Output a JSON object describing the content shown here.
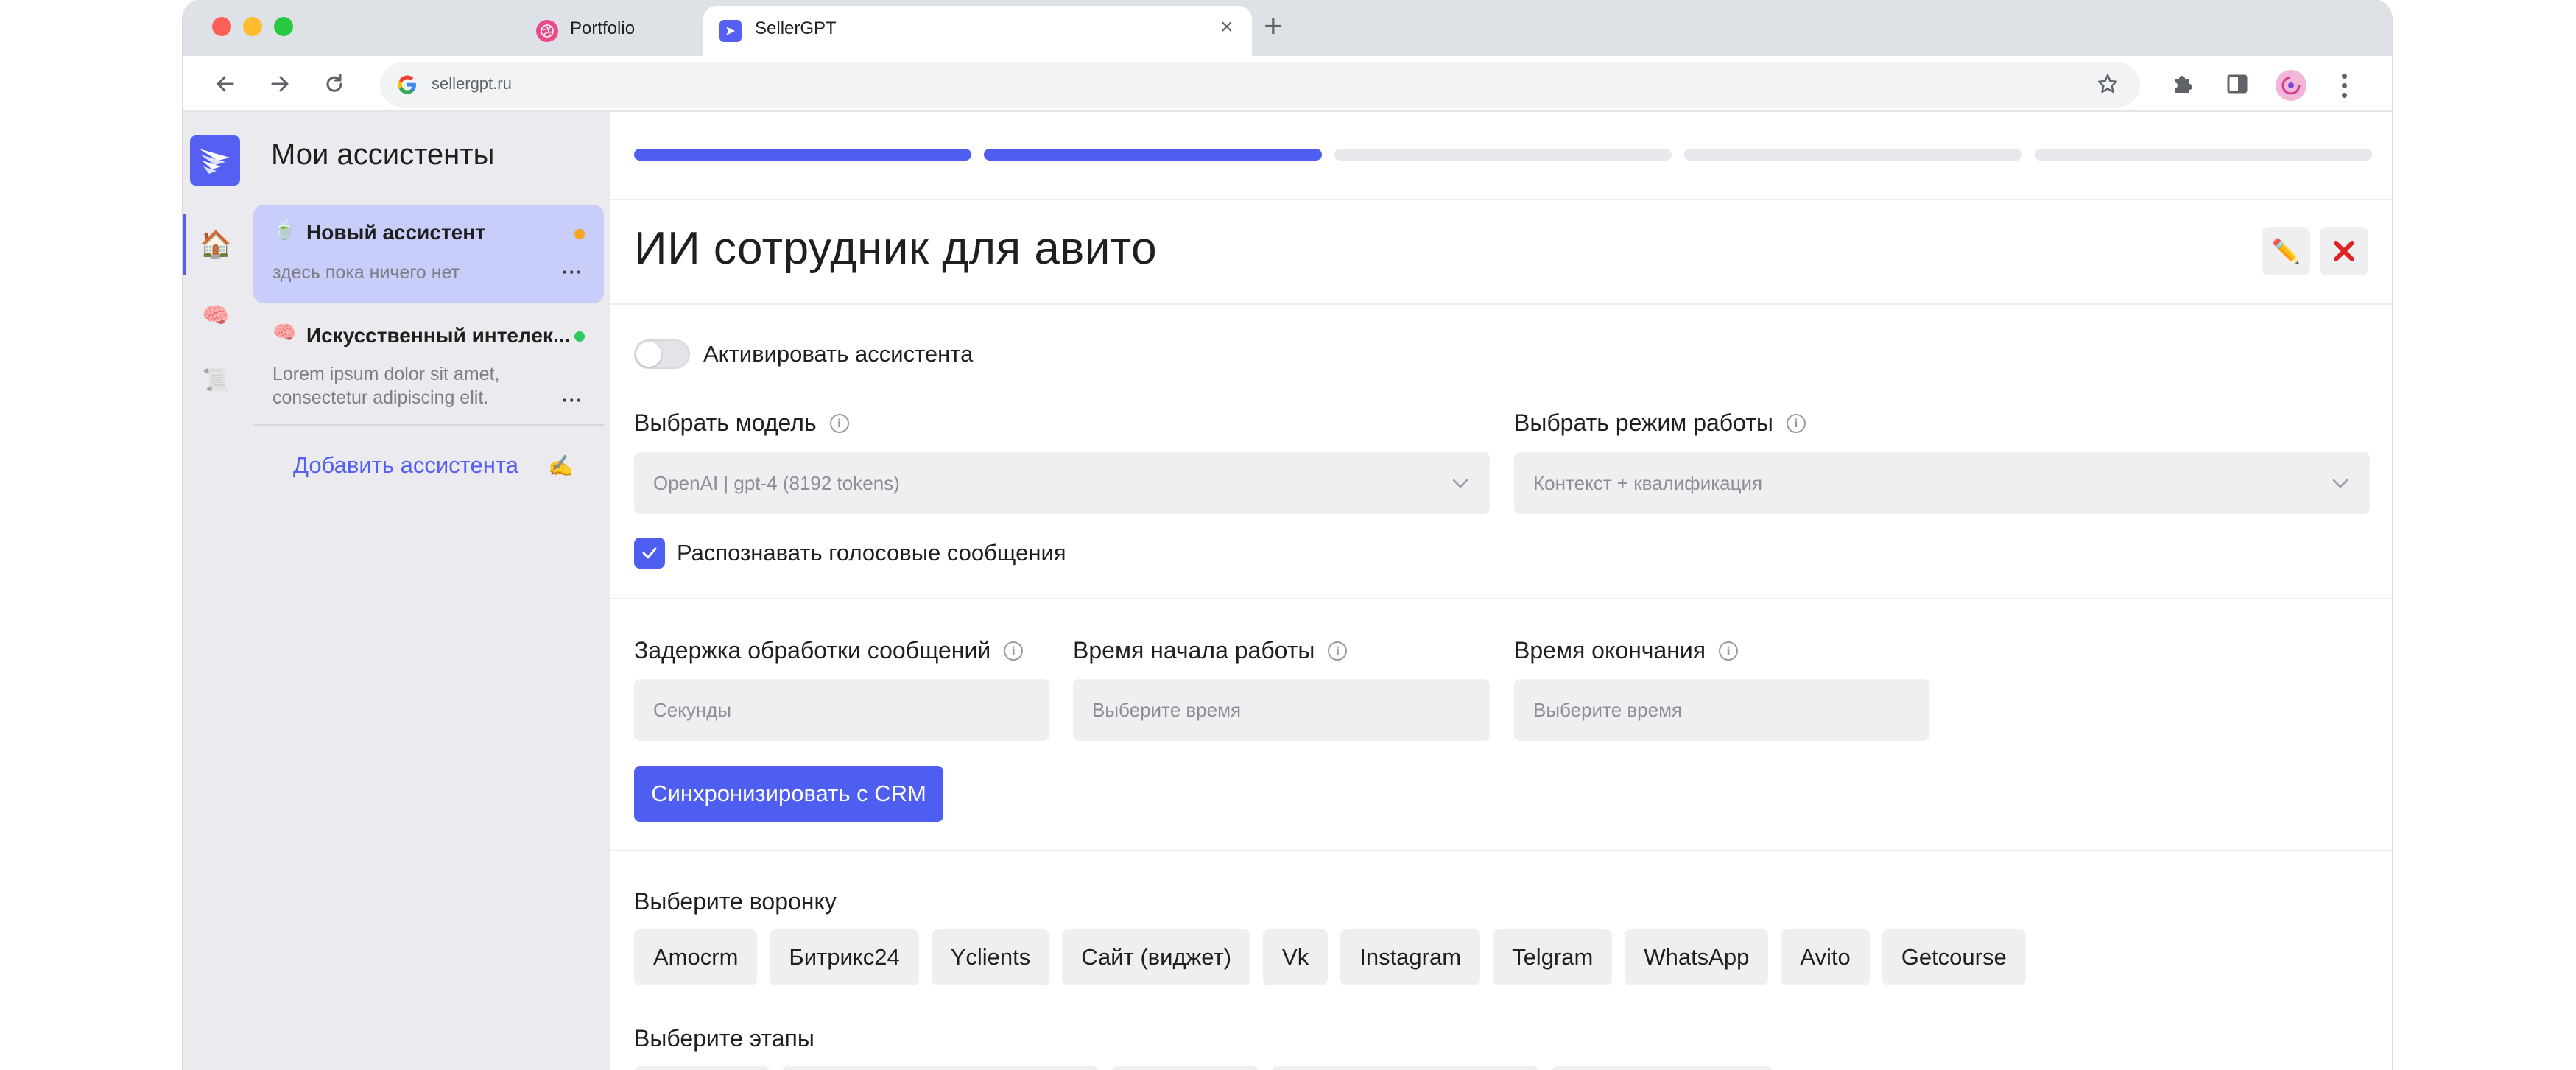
{
  "browser": {
    "tabs": [
      {
        "title": "Portfolio",
        "active": false,
        "favicon": "dribbble-icon"
      },
      {
        "title": "SellerGPT",
        "active": true,
        "favicon": "sellergpt-icon"
      }
    ],
    "url": "sellergpt.ru"
  },
  "sidebar": {
    "nav": [
      {
        "name": "home",
        "icon": "🏠"
      },
      {
        "name": "brain",
        "icon": "🧠"
      },
      {
        "name": "scroll",
        "icon": "📜"
      }
    ]
  },
  "assistants_panel": {
    "title": "Мои ассистенты",
    "items": [
      {
        "emoji": "🍵",
        "name": "Новый ассистент",
        "description": "здесь пока ничего нет",
        "status_color": "#f5a623",
        "more": "···"
      },
      {
        "emoji": "🧠",
        "name": "Искусственный интелек...",
        "description": "Lorem ipsum dolor sit amet, consectetur adipiscing elit.",
        "status_color": "#2ecc5f",
        "more": "···"
      }
    ],
    "add_label": "Добавить ассистента",
    "add_emoji": "✍️"
  },
  "main": {
    "steps_total": 5,
    "steps_done": 2,
    "title": "ИИ сотрудник для авито",
    "edit_emoji": "✏️",
    "toggle_label": "Активировать ассистента",
    "toggle_on": false,
    "model": {
      "label": "Выбрать модель",
      "value": "OpenAI | gpt-4 (8192 tokens)"
    },
    "mode": {
      "label": "Выбрать режим работы",
      "value": "Контекст + квалификация"
    },
    "voice_checkbox": {
      "label": "Распознавать голосовые сообщения",
      "checked": true
    },
    "delay": {
      "label": "Задержка обработки сообщений",
      "placeholder": "Секунды"
    },
    "start_time": {
      "label": "Время начала работы",
      "placeholder": "Выберите время"
    },
    "end_time": {
      "label": "Время окончания",
      "placeholder": "Выберите время"
    },
    "sync_button": "Синхронизировать с CRM",
    "funnel_label": "Выберите воронку",
    "funnels": [
      "Amocrm",
      "Битрикс24",
      "Yclients",
      "Сайт (виджет)",
      "Vk",
      "Instagram",
      "Telgram",
      "WhatsApp",
      "Avito",
      "Getcourse"
    ],
    "stages_label": "Выберите этапы"
  },
  "colors": {
    "accent": "#4d5ef0",
    "panel_bg": "#ebebef",
    "selected_card": "#c9cdfa",
    "field_bg": "#efeff2",
    "close_red": "#e02424"
  }
}
